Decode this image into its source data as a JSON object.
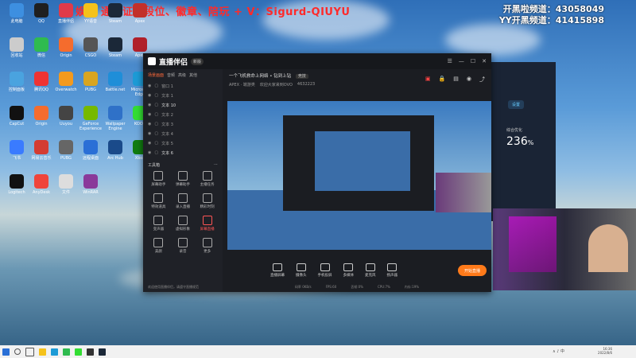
{
  "overlay": {
    "promo": "娱乐  通行证、段位、徽章、陪玩 + V：Sigurd-QIUYU",
    "channel_line1": "开黑啦频道：43058049",
    "channel_line2": "YY开黑频道：41415898"
  },
  "desktop_icons": [
    {
      "label": "此电脑",
      "color": "#3d8fe0"
    },
    {
      "label": "QQ",
      "color": "#1f1f1f"
    },
    {
      "label": "直播伴侣",
      "color": "#e03a4a"
    },
    {
      "label": "YY语音",
      "color": "#f5c21b"
    },
    {
      "label": "Steam",
      "color": "#1b2838"
    },
    {
      "label": "Apex",
      "color": "#c2302a"
    },
    {
      "label": "回收站",
      "color": "#ccc"
    },
    {
      "label": "微信",
      "color": "#2fbb4f"
    },
    {
      "label": "Origin",
      "color": "#f56c2d"
    },
    {
      "label": "CSGO",
      "color": "#555"
    },
    {
      "label": "Steam",
      "color": "#1b2838"
    },
    {
      "label": "Apex",
      "color": "#b0202a"
    },
    {
      "label": "控制面板",
      "color": "#4aa3df"
    },
    {
      "label": "腾讯QQ",
      "color": "#e33"
    },
    {
      "label": "Overwatch",
      "color": "#f39a1e"
    },
    {
      "label": "PUBG",
      "color": "#d9a520"
    },
    {
      "label": "Battle.net",
      "color": "#1f8ed8"
    },
    {
      "label": "Microsoft Edge",
      "color": "#1d9bd6"
    },
    {
      "label": "CapCut",
      "color": "#111"
    },
    {
      "label": "Origin",
      "color": "#f56c2d"
    },
    {
      "label": "Uuyou",
      "color": "#444"
    },
    {
      "label": "GeForce Experience",
      "color": "#76b900"
    },
    {
      "label": "Wallpaper Engine",
      "color": "#2f71c8"
    },
    {
      "label": "KOOK",
      "color": "#3d3"
    },
    {
      "label": "飞书",
      "color": "#3a7bff"
    },
    {
      "label": "网易云音乐",
      "color": "#d43c33"
    },
    {
      "label": "PUBG",
      "color": "#666"
    },
    {
      "label": "远程桌面",
      "color": "#2a6fd6"
    },
    {
      "label": "Arc Hub",
      "color": "#1a4a8a"
    },
    {
      "label": "Xbox",
      "color": "#107c10"
    },
    {
      "label": "Logitech",
      "color": "#111"
    },
    {
      "label": "AnyDesk",
      "color": "#ef443b"
    },
    {
      "label": "文件",
      "color": "#ddd"
    },
    {
      "label": "WinRAR",
      "color": "#8a3a9a"
    }
  ],
  "app": {
    "title": "直播伴侣",
    "version": "新版",
    "left_tabs": [
      "场景画面",
      "音频",
      "高级",
      "其他"
    ],
    "scenes": [
      "窗口 1",
      "文本 1",
      "文本 10",
      "文本 2",
      "文本 3",
      "文本 4",
      "文本 5",
      "文本 6"
    ],
    "tools_title": "工具箱",
    "tools": [
      "屏幕助手",
      "弹幕助手",
      "主播任务",
      "特效道具",
      "录入直播",
      "精彩时刻",
      "变声器",
      "虚拟形象",
      "屏幕直播",
      "美颜",
      "录音",
      "更多"
    ],
    "footer": "欢迎使用直播伴侣，请遵守直播规范",
    "stream_title": "一个飞机救命上网络 • 钻到上钻",
    "stream_tag": "竞技",
    "stream_meta": [
      "APEX · 端游类",
      "欢迎大家来到OVO",
      "4632223"
    ],
    "bottom_tools": [
      "直播屏幕",
      "摄像头",
      "手机投屏",
      "多媒体",
      "麦克风",
      "扬声器"
    ],
    "start_btn": "开始直播",
    "stats": [
      "码率 0KB/s",
      "FPS:60",
      "丢帧:0%",
      "CPU:7%",
      "内存:19%"
    ]
  },
  "back_window": {
    "settings_label": "设置",
    "opt_title": "综合优化",
    "opt_value": "236",
    "opt_unit": "%"
  },
  "taskbar": {
    "time": "16:36",
    "date": "2022/8/6"
  }
}
